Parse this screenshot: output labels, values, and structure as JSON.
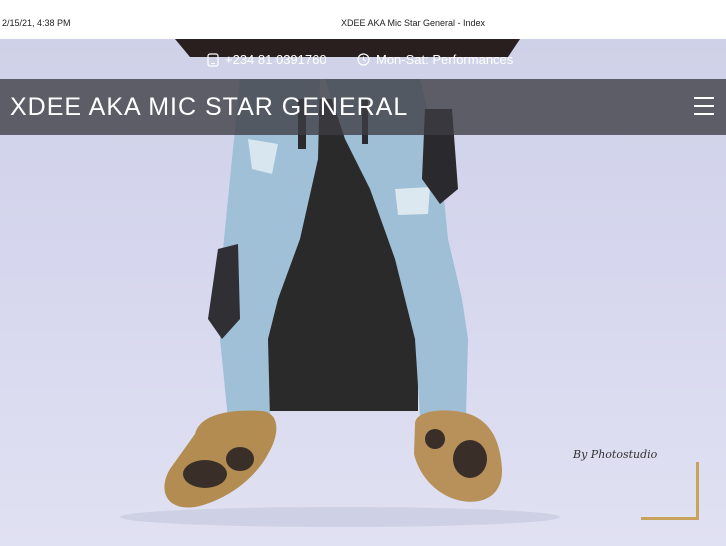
{
  "print_header": {
    "timestamp": "2/15/21, 4:38 PM",
    "page_title": "XDEE AKA Mic Star General - Index"
  },
  "topbar": {
    "phone": "+234 81 0391760",
    "hours": "Mon-Sat: Performances",
    "phone_icon": "phone-icon",
    "clock_icon": "clock-icon"
  },
  "navbar": {
    "brand": "XDEE AKA MIC STAR GENERAL",
    "menu_icon": "hamburger-menu-icon"
  },
  "hero": {
    "watermark": "By Photostudio",
    "accent_color": "#c9a25c"
  }
}
